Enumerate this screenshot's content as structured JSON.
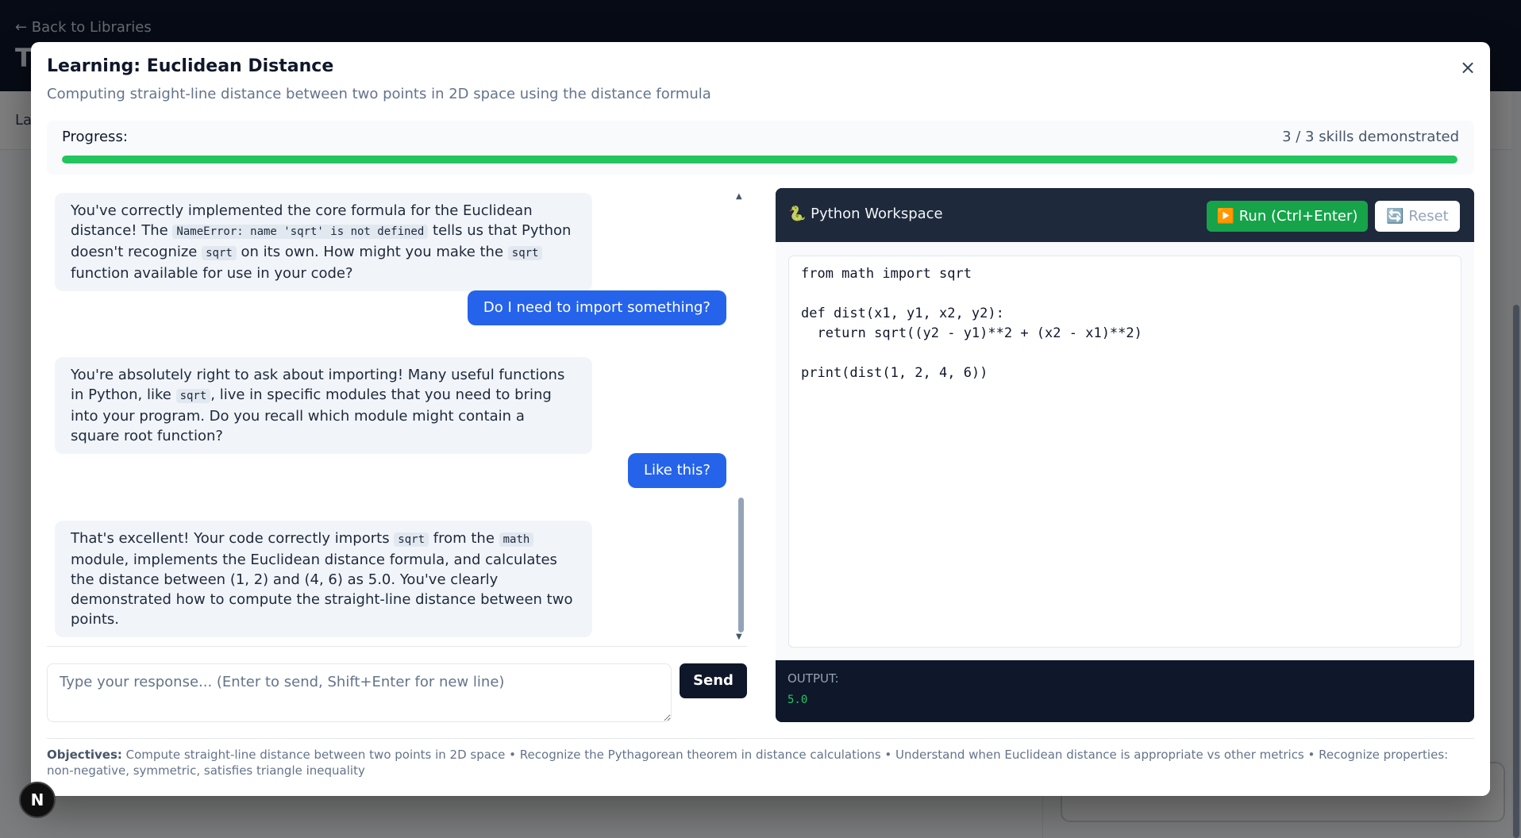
{
  "background": {
    "back_link": "← Back to Libraries",
    "title_glyph": "T",
    "nav_glyph": "La"
  },
  "modal": {
    "title": "Learning: Euclidean Distance",
    "subtitle": "Computing straight-line distance between two points in 2D space using the distance formula",
    "close_label": "×"
  },
  "progress": {
    "label": "Progress:",
    "count_text": "3 / 3 skills demonstrated",
    "fraction": 1.0
  },
  "chat": {
    "messages": [
      {
        "role": "assistant",
        "parts": [
          {
            "t": "text",
            "v": "You've correctly implemented the core formula for the Euclidean distance! The "
          },
          {
            "t": "code",
            "v": "NameError: name 'sqrt' is not defined"
          },
          {
            "t": "text",
            "v": " tells us that Python doesn't recognize "
          },
          {
            "t": "code",
            "v": "sqrt"
          },
          {
            "t": "text",
            "v": " on its own. How might you make the "
          },
          {
            "t": "code",
            "v": "sqrt"
          },
          {
            "t": "text",
            "v": " function available for use in your code?"
          }
        ]
      },
      {
        "role": "user",
        "text": "Do I need to import something?"
      },
      {
        "role": "assistant",
        "parts": [
          {
            "t": "text",
            "v": "You're absolutely right to ask about importing! Many useful functions in Python, like "
          },
          {
            "t": "code",
            "v": "sqrt"
          },
          {
            "t": "text",
            "v": ", live in specific modules that you need to bring into your program. Do you recall which module might contain a square root function?"
          }
        ]
      },
      {
        "role": "user",
        "text": "Like this?"
      },
      {
        "role": "assistant",
        "parts": [
          {
            "t": "text",
            "v": "That's excellent! Your code correctly imports "
          },
          {
            "t": "code",
            "v": "sqrt"
          },
          {
            "t": "text",
            "v": " from the "
          },
          {
            "t": "code",
            "v": "math"
          },
          {
            "t": "text",
            "v": " module, implements the Euclidean distance formula, and calculates the distance between (1, 2) and (4, 6) as 5.0. You've clearly demonstrated how to compute the straight-line distance between two points."
          }
        ]
      }
    ],
    "input_placeholder": "Type your response... (Enter to send, Shift+Enter for new line)",
    "send_label": "Send"
  },
  "workspace": {
    "title": "🐍 Python Workspace",
    "run_label": "▶️ Run (Ctrl+Enter)",
    "reset_label": "🔄 Reset",
    "code": "from math import sqrt\n\ndef dist(x1, y1, x2, y2):\n  return sqrt((y2 - y1)**2 + (x2 - x1)**2)\n\nprint(dist(1, 2, 4, 6))",
    "output_label": "OUTPUT:",
    "output_value": "5.0"
  },
  "objectives": {
    "label": "Objectives:",
    "text": " Compute straight-line distance between two points in 2D space • Recognize the Pythagorean theorem in distance calculations • Understand when Euclidean distance is appropriate vs other metrics • Recognize properties: non-negative, symmetric, satisfies triangle inequality"
  },
  "badge": {
    "letter": "N"
  },
  "colors": {
    "progress": "#22c55e",
    "user_bubble": "#2563eb",
    "run_button": "#16a34a",
    "workspace_header": "#1e293b"
  }
}
